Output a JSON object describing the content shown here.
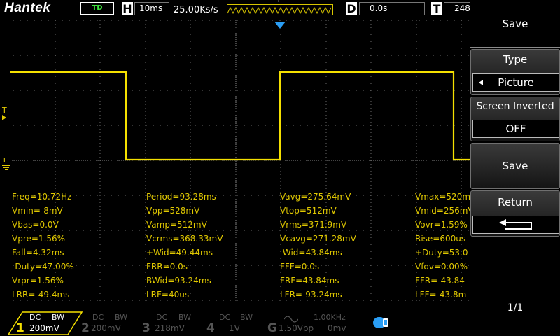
{
  "header": {
    "brand": "Hantek",
    "run_status": "TD",
    "timebase_label": "H",
    "timebase_value": "10ms",
    "sample_rate": "25.00Ks/s",
    "trigger_marker": "T",
    "delay_label": "D",
    "delay_value": "0.0s",
    "trigger_label": "T",
    "trigger_value": "248"
  },
  "markers": {
    "trigger_level": "T",
    "ch1_ground": "1"
  },
  "colors": {
    "ch1": "#f5e000",
    "trigger_pointer": "#2a9df4",
    "grid_dot": "#6a6a6a"
  },
  "measurements": [
    [
      "Freq=10.72Hz",
      "Period=93.28ms",
      "Vavg=275.64mV",
      "Vmax=520mV"
    ],
    [
      "Vmin=-8mV",
      "Vpp=528mV",
      "Vtop=512mV",
      "Vmid=256mV"
    ],
    [
      "Vbas=0.0V",
      "Vamp=512mV",
      "Vrms=371.9mV",
      "Vovr=1.59%"
    ],
    [
      "Vpre=1.56%",
      "Vcrms=368.33mV",
      "Vcavg=271.28mV",
      "Rise=600us"
    ],
    [
      "Fall=4.32ms",
      "+Wid=49.44ms",
      "-Wid=43.84ms",
      "+Duty=53.0"
    ],
    [
      "-Duty=47.00%",
      "FRR=0.0s",
      "FFF=0.0s",
      "Vfov=0.00%"
    ],
    [
      "Vrpr=1.56%",
      "BWid=93.24ms",
      "FRF=43.84ms",
      "FFR=-43.84"
    ],
    [
      "LRR=-49.4ms",
      "LRF=40us",
      "LFR=-93.24ms",
      "LFF=-43.8m"
    ]
  ],
  "channels": [
    {
      "num": "1",
      "coupling": "DC",
      "bw": "BW",
      "scale": "200mV",
      "active": true
    },
    {
      "num": "2",
      "coupling": "DC",
      "bw": "BW",
      "scale": "200mV",
      "active": false
    },
    {
      "num": "3",
      "coupling": "DC",
      "bw": "BW",
      "scale": "218mV",
      "active": false
    },
    {
      "num": "4",
      "coupling": "DC",
      "bw": "BW",
      "scale": "1V",
      "active": false
    }
  ],
  "generator": {
    "label": "G",
    "wave_icon": "sine-wave-icon",
    "freq": "1.00KHz",
    "amp": "1.50Vpp",
    "offset": "0mv"
  },
  "menu": {
    "title": "Save",
    "type_label": "Type",
    "type_value": "Picture",
    "screen_inverted_label": "Screen Inverted",
    "screen_inverted_value": "OFF",
    "save_label": "Save",
    "return_label": "Return",
    "page": "1/1"
  }
}
